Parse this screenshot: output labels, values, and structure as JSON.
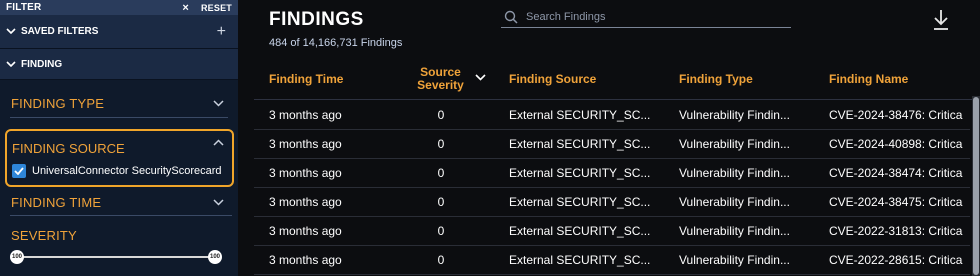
{
  "sidebar": {
    "header": {
      "title": "FILTER",
      "close": "×",
      "reset": "RESET"
    },
    "saved_filters": {
      "label": "SAVED FILTERS",
      "add": "+"
    },
    "finding_section": {
      "label": "FINDING"
    },
    "finding_type": {
      "label": "FINDING TYPE"
    },
    "finding_source": {
      "label": "FINDING SOURCE",
      "option": "UniversalConnector SecurityScorecard",
      "checked": true
    },
    "finding_time": {
      "label": "FINDING TIME"
    },
    "severity": {
      "label": "SEVERITY",
      "min": "100",
      "max": "100"
    }
  },
  "main": {
    "title": "FINDINGS",
    "count": "484 of 14,166,731 Findings",
    "search_placeholder": "Search Findings",
    "columns": {
      "finding_time": "Finding Time",
      "source_severity_1": "Source",
      "source_severity_2": "Severity",
      "finding_source": "Finding Source",
      "finding_type": "Finding Type",
      "finding_name": "Finding Name"
    },
    "rows": [
      {
        "time": "3 months ago",
        "severity": "0",
        "source": "External SECURITY_SC...",
        "type": "Vulnerability Findin...",
        "name": "CVE-2024-38476: Critica"
      },
      {
        "time": "3 months ago",
        "severity": "0",
        "source": "External SECURITY_SC...",
        "type": "Vulnerability Findin...",
        "name": "CVE-2024-40898: Critica"
      },
      {
        "time": "3 months ago",
        "severity": "0",
        "source": "External SECURITY_SC...",
        "type": "Vulnerability Findin...",
        "name": "CVE-2024-38474: Critica"
      },
      {
        "time": "3 months ago",
        "severity": "0",
        "source": "External SECURITY_SC...",
        "type": "Vulnerability Findin...",
        "name": "CVE-2024-38475: Critica"
      },
      {
        "time": "3 months ago",
        "severity": "0",
        "source": "External SECURITY_SC...",
        "type": "Vulnerability Findin...",
        "name": "CVE-2022-31813: Critica"
      },
      {
        "time": "3 months ago",
        "severity": "0",
        "source": "External SECURITY_SC...",
        "type": "Vulnerability Findin...",
        "name": "CVE-2022-28615: Critica"
      }
    ]
  },
  "colors": {
    "accent": "#f0a33a",
    "sidebar_bg": "#0f1a2b",
    "checkbox": "#2e86d9",
    "highlight_border": "#f0a52a"
  }
}
